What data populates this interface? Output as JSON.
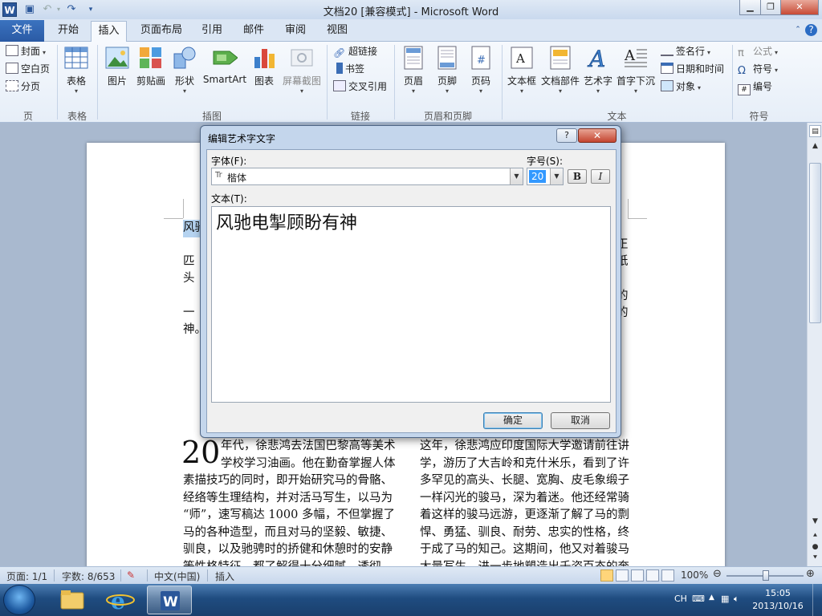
{
  "title_bar": {
    "title": "文档20 [兼容模式] - Microsoft Word",
    "app_letter": "W"
  },
  "tabs": {
    "file": "文件",
    "items": [
      "开始",
      "插入",
      "页面布局",
      "引用",
      "邮件",
      "审阅",
      "视图"
    ],
    "active": "插入"
  },
  "ribbon": {
    "pages_group": {
      "label": "页",
      "cover": "封面",
      "blank": "空白页",
      "break": "分页"
    },
    "table_group": {
      "label": "表格",
      "table": "表格"
    },
    "illustrations_group": {
      "label": "插图",
      "picture": "图片",
      "clipart": "剪贴画",
      "shapes": "形状",
      "smartart": "SmartArt",
      "chart": "图表",
      "screenshot": "屏幕截图"
    },
    "links_group": {
      "label": "链接",
      "hyperlink": "超链接",
      "bookmark": "书签",
      "crossref": "交叉引用"
    },
    "header_footer_group": {
      "label": "页眉和页脚",
      "header": "页眉",
      "footer": "页脚",
      "page_number": "页码"
    },
    "text_group": {
      "label": "文本",
      "textbox": "文本框",
      "quickparts": "文档部件",
      "wordart": "艺术字",
      "dropcap": "首字下沉",
      "signature": "签名行",
      "datetime": "日期和时间",
      "object": "对象"
    },
    "symbols_group": {
      "label": "符号",
      "equation": "公式",
      "symbol": "符号",
      "number": "编号"
    }
  },
  "document": {
    "selected_line": "风驰",
    "left_fragments": [
      "匹",
      "头",
      "一",
      "神。"
    ],
    "right_fragments": [
      "正",
      "纸",
      "的",
      "的"
    ],
    "dropcap": "20",
    "col1_lines": [
      "年代，徐悲鸿去法国巴黎高等美术",
      "学校学习油画。他在勤奋掌握人体",
      "素描技巧的同时，即开始研究马的骨骼、",
      "经络等生理结构，并对活马写生，以马为",
      "“师”，速写稿达 1000 多幅，不但掌握了",
      "马的各种造型，而且对马的坚毅、敏捷、",
      "驯良，以及驰骋时的挢健和休憩时的安静",
      "等性格特征，都了解得十分细腻。透彻"
    ],
    "col2_lines": [
      "这年，徐悲鸿应印度国际大学邀请前往讲",
      "学，游历了大吉岭和克什米乐，看到了许",
      "多罕见的高头、长腿、宽胸、皮毛象缎子",
      "一样闪光的骏马，深为着迷。他还经常骑",
      "着这样的骏马远游，更逐渐了解了马的剽",
      "悍、勇猛、驯良、耐劳、忠实的性格，终",
      "于成了马的知己。这期间，他又对着骏马",
      "大量写生，进一步地塑造出千姿百态的奔"
    ]
  },
  "dialog": {
    "title": "编辑艺术字文字",
    "help": "?",
    "close": "✕",
    "font_label": "字体(F):",
    "font_value": "楷体",
    "size_label": "字号(S):",
    "size_value": "20",
    "bold": "B",
    "italic": "I",
    "text_label": "文本(T):",
    "text_value": "风驰电掣顾盼有神",
    "ok": "确定",
    "cancel": "取消"
  },
  "status_bar": {
    "page": "页面: 1/1",
    "words": "字数: 8/653",
    "language": "中文(中国)",
    "mode": "插入",
    "zoom": "100%"
  },
  "taskbar": {
    "ime": "CH",
    "time": "15:05",
    "date": "2013/10/16"
  },
  "colors": {
    "ribbon_active": "#2b579a",
    "selection": "#b5d3f0"
  }
}
